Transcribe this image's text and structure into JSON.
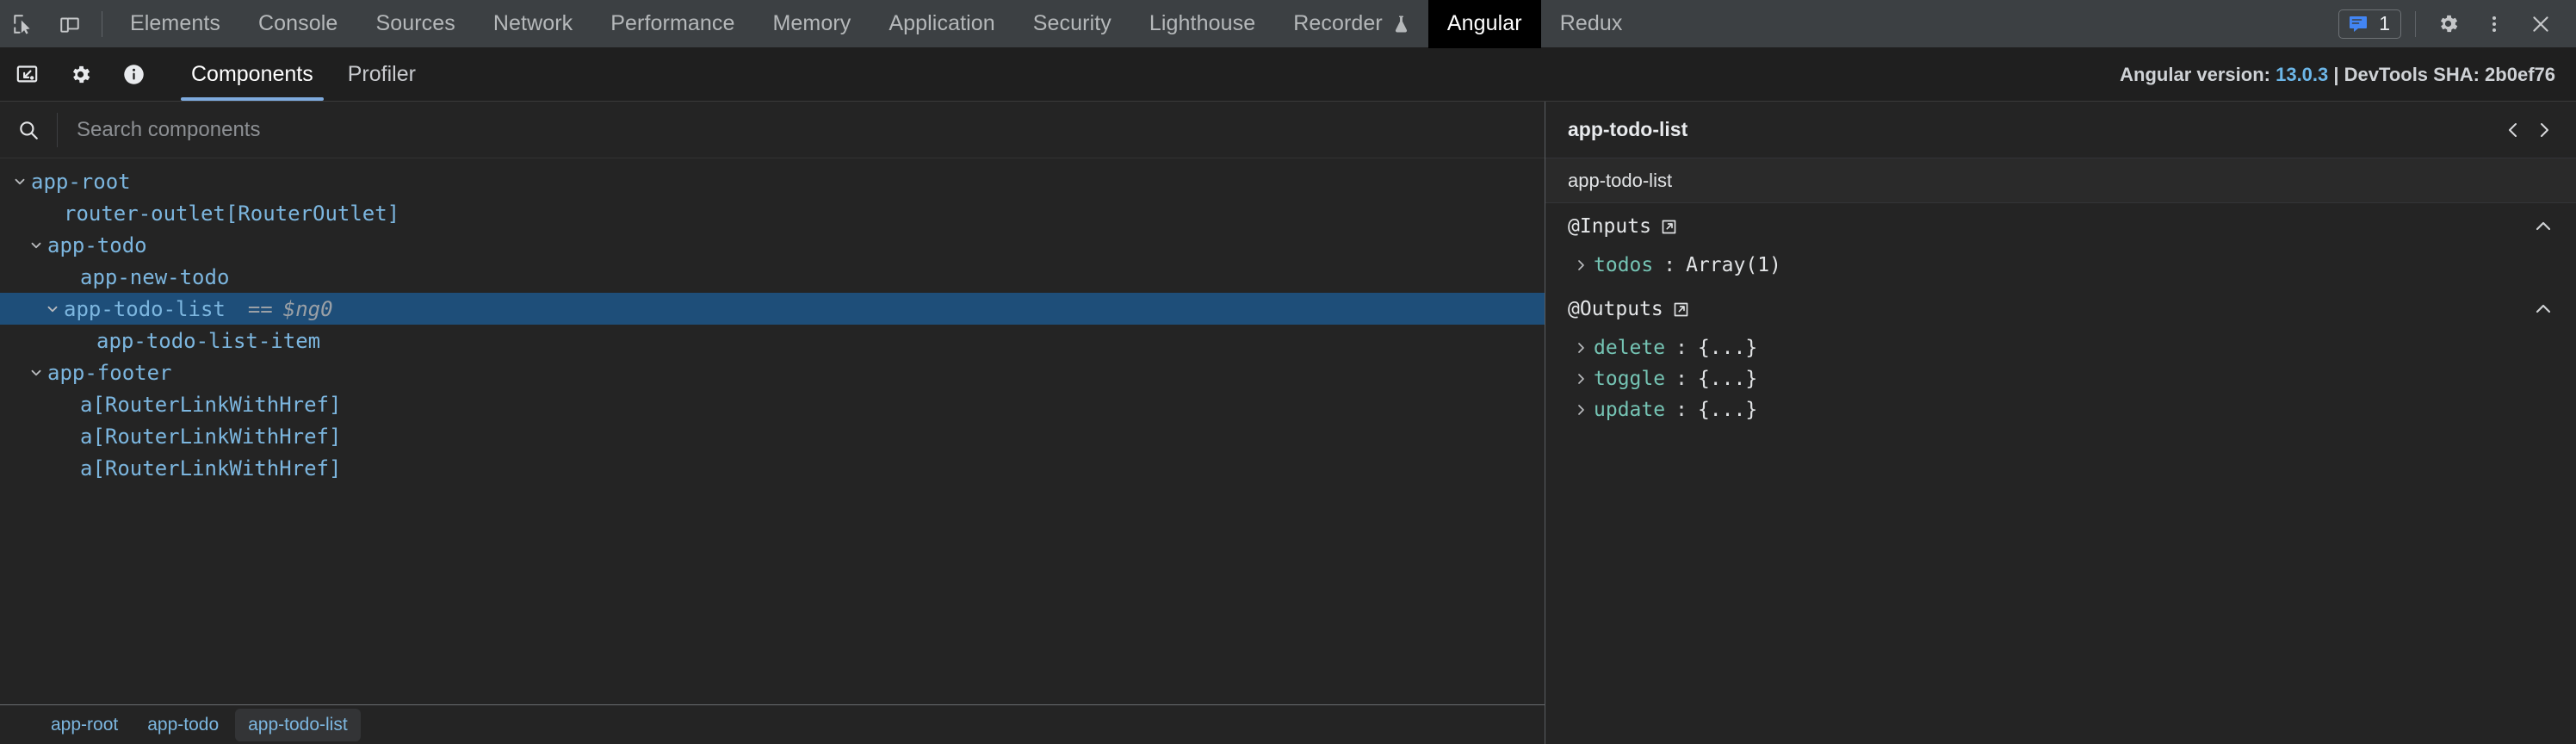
{
  "devtools_bar": {
    "icons": [
      {
        "name": "inspect-element-icon"
      },
      {
        "name": "device-toolbar-icon"
      }
    ],
    "tabs": [
      {
        "label": "Elements",
        "active": false
      },
      {
        "label": "Console",
        "active": false
      },
      {
        "label": "Sources",
        "active": false
      },
      {
        "label": "Network",
        "active": false
      },
      {
        "label": "Performance",
        "active": false
      },
      {
        "label": "Memory",
        "active": false
      },
      {
        "label": "Application",
        "active": false
      },
      {
        "label": "Security",
        "active": false
      },
      {
        "label": "Lighthouse",
        "active": false
      },
      {
        "label": "Recorder",
        "active": false,
        "icon": "flask-icon"
      },
      {
        "label": "Angular",
        "active": true
      },
      {
        "label": "Redux",
        "active": false
      }
    ],
    "message_count": "1",
    "right_icons": [
      {
        "name": "messages-icon"
      },
      {
        "name": "settings-gear-icon"
      },
      {
        "name": "more-options-icon"
      },
      {
        "name": "close-icon"
      }
    ],
    "accent_color": "#4285f4"
  },
  "angular_bar": {
    "icons": [
      {
        "name": "inspector-target-icon"
      },
      {
        "name": "settings-gear-icon"
      },
      {
        "name": "info-icon"
      }
    ],
    "tabs": [
      {
        "label": "Components",
        "active": true
      },
      {
        "label": "Profiler",
        "active": false
      }
    ],
    "version_prefix": "Angular version:",
    "version": "13.0.3",
    "sha_text": "| DevTools SHA: 2b0ef76",
    "version_color": "#6cb6e8"
  },
  "search": {
    "placeholder": "Search components",
    "value": ""
  },
  "tree": {
    "nodes": [
      {
        "label": "app-root",
        "indent": 0,
        "twisty": "expanded",
        "selected": false,
        "id": "",
        "type": "component"
      },
      {
        "label": "router-outlet",
        "suffix": "[RouterOutlet]",
        "indent": 1,
        "twisty": "none",
        "selected": false,
        "id": "",
        "type": "directive"
      },
      {
        "label": "app-todo",
        "indent": 1,
        "twisty": "expanded",
        "selected": false,
        "id": "",
        "type": "component"
      },
      {
        "label": "app-new-todo",
        "indent": 2,
        "twisty": "none",
        "selected": false,
        "id": "",
        "type": "component"
      },
      {
        "label": "app-todo-list",
        "indent": 2,
        "twisty": "expanded",
        "selected": true,
        "id": "$ng0",
        "eq": "==",
        "type": "component"
      },
      {
        "label": "app-todo-list-item",
        "indent": 3,
        "twisty": "none",
        "selected": false,
        "id": "",
        "type": "component"
      },
      {
        "label": "app-footer",
        "indent": 1,
        "twisty": "expanded",
        "selected": false,
        "id": "",
        "type": "component"
      },
      {
        "label": "a",
        "suffix": "[RouterLinkWithHref]",
        "indent": 2,
        "twisty": "none",
        "selected": false,
        "id": "",
        "type": "directive"
      },
      {
        "label": "a",
        "suffix": "[RouterLinkWithHref]",
        "indent": 2,
        "twisty": "none",
        "selected": false,
        "id": "",
        "type": "directive"
      },
      {
        "label": "a",
        "suffix": "[RouterLinkWithHref]",
        "indent": 2,
        "twisty": "none",
        "selected": false,
        "id": "",
        "type": "directive"
      }
    ],
    "selected_highlight_color": "#1e4e79"
  },
  "breadcrumbs": [
    {
      "label": "app-root",
      "active": false
    },
    {
      "label": "app-todo",
      "active": false
    },
    {
      "label": "app-todo-list",
      "active": true
    }
  ],
  "details": {
    "header_title": "app-todo-list",
    "subheader_title": "app-todo-list",
    "nav_prev_icon": "chevron-left-icon",
    "nav_next_icon": "chevron-right-icon",
    "sections": [
      {
        "title": "@Inputs",
        "collapsed": false,
        "properties": [
          {
            "key": "todos",
            "value": "Array(1)"
          }
        ]
      },
      {
        "title": "@Outputs",
        "collapsed": false,
        "properties": [
          {
            "key": "delete",
            "value": "{...}"
          },
          {
            "key": "toggle",
            "value": "{...}"
          },
          {
            "key": "update",
            "value": "{...}"
          }
        ]
      }
    ],
    "key_color": "#75c4b4"
  }
}
